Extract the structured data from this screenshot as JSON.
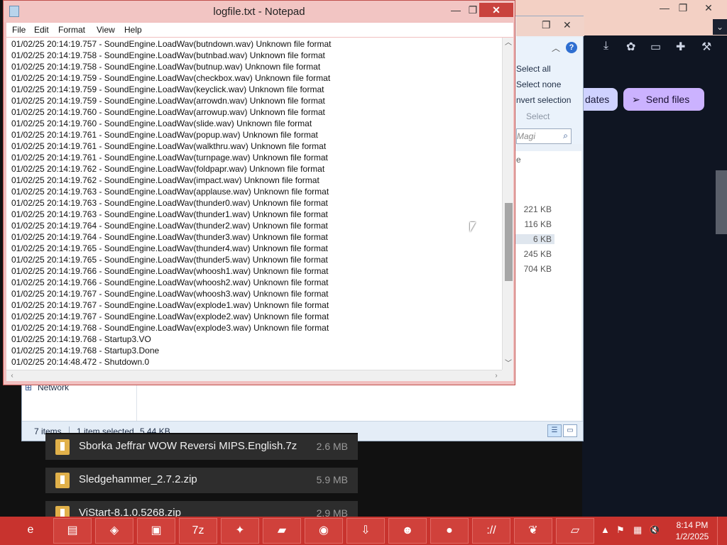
{
  "browser": {
    "send_files_label": "Send files",
    "updates_label": "dates",
    "window_controls": {
      "minimize": "—",
      "maximize": "❐",
      "close": "✕"
    }
  },
  "explorer": {
    "ribbon": {
      "select_all": "Select all",
      "select_none": "Select none",
      "invert_selection": "nvert selection",
      "select": "Select"
    },
    "search_placeholder": "Magi",
    "column_fragment": "e",
    "sizes": [
      "221 KB",
      "116 KB",
      "6 KB",
      "245 KB",
      "704 KB"
    ],
    "nav_network": "Network",
    "status": {
      "items": "7 items",
      "selected": "1 item selected",
      "size": "5.44 KB"
    }
  },
  "downloads": [
    {
      "name": "Sborka Jeffrar WOW Reversi MIPS.English.7z",
      "size": "2.6 MB"
    },
    {
      "name": "Sledgehammer_2.7.2.zip",
      "size": "5.9 MB"
    },
    {
      "name": "ViStart-8.1.0.5268.zip",
      "size": "2.9 MB"
    }
  ],
  "notepad": {
    "title": "logfile.txt - Notepad",
    "menu": {
      "file": "File",
      "edit": "Edit",
      "format": "Format",
      "view": "View",
      "help": "Help"
    },
    "lines": [
      "01/02/25 20:14:19.757 - SoundEngine.LoadWav(butndown.wav) Unknown file format",
      "01/02/25 20:14:19.758 - SoundEngine.LoadWav(butnbad.wav) Unknown file format",
      "01/02/25 20:14:19.758 - SoundEngine.LoadWav(butnup.wav) Unknown file format",
      "01/02/25 20:14:19.759 - SoundEngine.LoadWav(checkbox.wav) Unknown file format",
      "01/02/25 20:14:19.759 - SoundEngine.LoadWav(keyclick.wav) Unknown file format",
      "01/02/25 20:14:19.759 - SoundEngine.LoadWav(arrowdn.wav) Unknown file format",
      "01/02/25 20:14:19.760 - SoundEngine.LoadWav(arrowup.wav) Unknown file format",
      "01/02/25 20:14:19.760 - SoundEngine.LoadWav(slide.wav) Unknown file format",
      "01/02/25 20:14:19.761 - SoundEngine.LoadWav(popup.wav) Unknown file format",
      "01/02/25 20:14:19.761 - SoundEngine.LoadWav(walkthru.wav) Unknown file format",
      "01/02/25 20:14:19.761 - SoundEngine.LoadWav(turnpage.wav) Unknown file format",
      "01/02/25 20:14:19.762 - SoundEngine.LoadWav(foldpapr.wav) Unknown file format",
      "01/02/25 20:14:19.762 - SoundEngine.LoadWav(impact.wav) Unknown file format",
      "01/02/25 20:14:19.763 - SoundEngine.LoadWav(applause.wav) Unknown file format",
      "01/02/25 20:14:19.763 - SoundEngine.LoadWav(thunder0.wav) Unknown file format",
      "01/02/25 20:14:19.763 - SoundEngine.LoadWav(thunder1.wav) Unknown file format",
      "01/02/25 20:14:19.764 - SoundEngine.LoadWav(thunder2.wav) Unknown file format",
      "01/02/25 20:14:19.764 - SoundEngine.LoadWav(thunder3.wav) Unknown file format",
      "01/02/25 20:14:19.765 - SoundEngine.LoadWav(thunder4.wav) Unknown file format",
      "01/02/25 20:14:19.765 - SoundEngine.LoadWav(thunder5.wav) Unknown file format",
      "01/02/25 20:14:19.766 - SoundEngine.LoadWav(whoosh1.wav) Unknown file format",
      "01/02/25 20:14:19.766 - SoundEngine.LoadWav(whoosh2.wav) Unknown file format",
      "01/02/25 20:14:19.767 - SoundEngine.LoadWav(whoosh3.wav) Unknown file format",
      "01/02/25 20:14:19.767 - SoundEngine.LoadWav(explode1.wav) Unknown file format",
      "01/02/25 20:14:19.767 - SoundEngine.LoadWav(explode2.wav) Unknown file format",
      "01/02/25 20:14:19.768 - SoundEngine.LoadWav(explode3.wav) Unknown file format",
      "01/02/25 20:14:19.768 - Startup3.VO",
      "01/02/25 20:14:19.768 - Startup3.Done",
      "01/02/25 20:14:48.472 - Shutdown.0"
    ]
  },
  "taskbar": {
    "apps": [
      {
        "name": "internet-explorer-icon",
        "glyph": "e"
      },
      {
        "name": "file-explorer-icon",
        "glyph": "▤"
      },
      {
        "name": "pink-app-icon",
        "glyph": "◈"
      },
      {
        "name": "window-app-icon",
        "glyph": "▣"
      },
      {
        "name": "7zip-icon",
        "glyph": "7z"
      },
      {
        "name": "chart-app-icon",
        "glyph": "✦"
      },
      {
        "name": "usb-drive-icon",
        "glyph": "▰"
      },
      {
        "name": "podcast-icon",
        "glyph": "◉"
      },
      {
        "name": "download-manager-icon",
        "glyph": "⇩"
      },
      {
        "name": "mascot-app-icon",
        "glyph": "☻"
      },
      {
        "name": "globe-icon",
        "glyph": "●"
      },
      {
        "name": "slash-app-icon",
        "glyph": "://"
      },
      {
        "name": "red-dragon-icon",
        "glyph": "❦"
      },
      {
        "name": "notepad-icon",
        "glyph": "▱"
      }
    ],
    "tray": {
      "chevron": "▲",
      "flag": "⚑",
      "network": "▦",
      "volume": "🔇"
    },
    "clock_time": "8:14 PM",
    "clock_date": "1/2/2025"
  },
  "colors": {
    "taskbar": "#c8332e",
    "notepad_border": "#c0504d",
    "send_button": "#cbb2ff"
  }
}
